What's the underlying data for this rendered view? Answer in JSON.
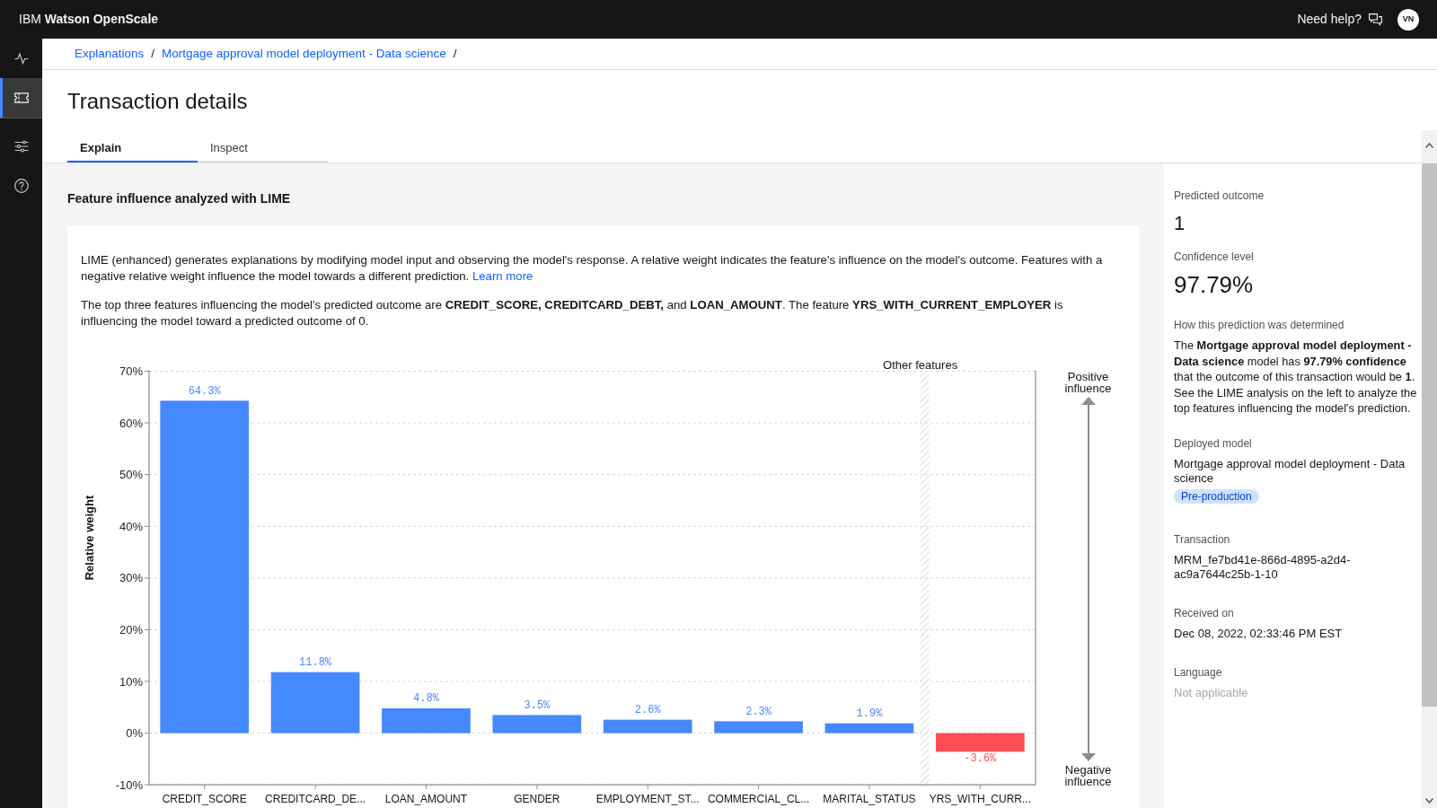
{
  "header": {
    "product_name": "IBM **Watson OpenScale**",
    "help_link": "Need help?",
    "avatar_initials": "VN"
  },
  "sidebar": {
    "groups": [
      {
        "items": [
          {
            "kind": "pulse",
            "selected": false
          },
          {
            "kind": "ticket",
            "selected": true
          }
        ]
      },
      {
        "items": [
          {
            "kind": "sliders",
            "selected": false
          },
          {
            "kind": "help",
            "selected": false
          }
        ]
      }
    ]
  },
  "breadcrumbs": [
    {
      "label": "Explanations",
      "separator": "/"
    },
    {
      "label": "Mortgage approval model deployment - Data science",
      "separator": "/"
    }
  ],
  "page_title": "Transaction details",
  "tabs": [
    {
      "label": "Explain",
      "selected": true
    },
    {
      "label": "Inspect",
      "selected": false
    }
  ],
  "explain": {
    "title": "Feature influence analyzed with LIME",
    "paragraphs": [
      {
        "text": "LIME (enhanced) generates explanations by modifying model input and observing the model's response. A relative weight indicates the feature's influence on the model's outcome. Features with a negative relative weight influence the model towards a different prediction.",
        "link": "Learn more"
      },
      {
        "text": "The top three features influencing the model's predicted outcome are **CREDIT_SCORE, CREDITCARD_DEBT,** and **LOAN_AMOUNT**. The feature **YRS_WITH_CURRENT_EMPLOYER** is influencing the model toward a predicted outcome of 0."
      }
    ],
    "chart_data": {
      "type": "bar",
      "ylabel": "Relative weight",
      "categories": [
        "CREDIT_SCORE",
        "CREDITCARD_DE...",
        "LOAN_AMOUNT",
        "GENDER",
        "EMPLOYMENT_ST...",
        "COMMERCIAL_CL...",
        "MARITAL_STATUS",
        "YRS_WITH_CURR..."
      ],
      "values": [
        64.3,
        11.8,
        4.8,
        3.5,
        2.6,
        2.3,
        1.9,
        -3.6
      ],
      "value_labels": [
        "64.3%",
        "11.8%",
        "4.8%",
        "3.5%",
        "2.6%",
        "2.3%",
        "1.9%",
        "-3.6%"
      ],
      "ylim": [
        -10,
        70
      ],
      "yticks": [
        {
          "value": -10,
          "label": "-10%"
        },
        {
          "value": 0,
          "label": "0%"
        },
        {
          "value": 10,
          "label": "10%"
        },
        {
          "value": 20,
          "label": "20%"
        },
        {
          "value": 30,
          "label": "30%"
        },
        {
          "value": 40,
          "label": "40%"
        },
        {
          "value": 50,
          "label": "50%"
        },
        {
          "value": 60,
          "label": "60%"
        },
        {
          "value": 70,
          "label": "70%"
        }
      ],
      "grid": true,
      "annotations": [
        "Other features"
      ]
    },
    "influence_axis": {
      "top_label": "Positive influence",
      "bottom_label": "Negative influence"
    }
  },
  "summary": {
    "predicted_outcome": {
      "label": "Predicted outcome",
      "value": "1"
    },
    "confidence": {
      "label": "Confidence level",
      "value": "97.79%"
    },
    "explanation": {
      "label": "How this prediction was determined",
      "text": "The **Mortgage approval model deployment - Data science** model has **97.79% confidence** that the outcome of this transaction would be **1**. See the LIME analysis on the left to analyze the top features influencing the model's prediction."
    },
    "details": [
      {
        "label": "Deployed model",
        "value": "Mortgage approval model deployment - Data science",
        "tag": "Pre-production",
        "disabled": false
      },
      {
        "label": "Transaction",
        "value": "MRM_fe7bd41e-866d-4895-a2d4-ac9a7644c25b-1-10",
        "disabled": false
      },
      {
        "label": "Received on",
        "value": "Dec 08, 2022, 02:33:46 PM EST",
        "disabled": false
      },
      {
        "label": "Language",
        "value": "Not applicable",
        "disabled": true
      }
    ]
  }
}
